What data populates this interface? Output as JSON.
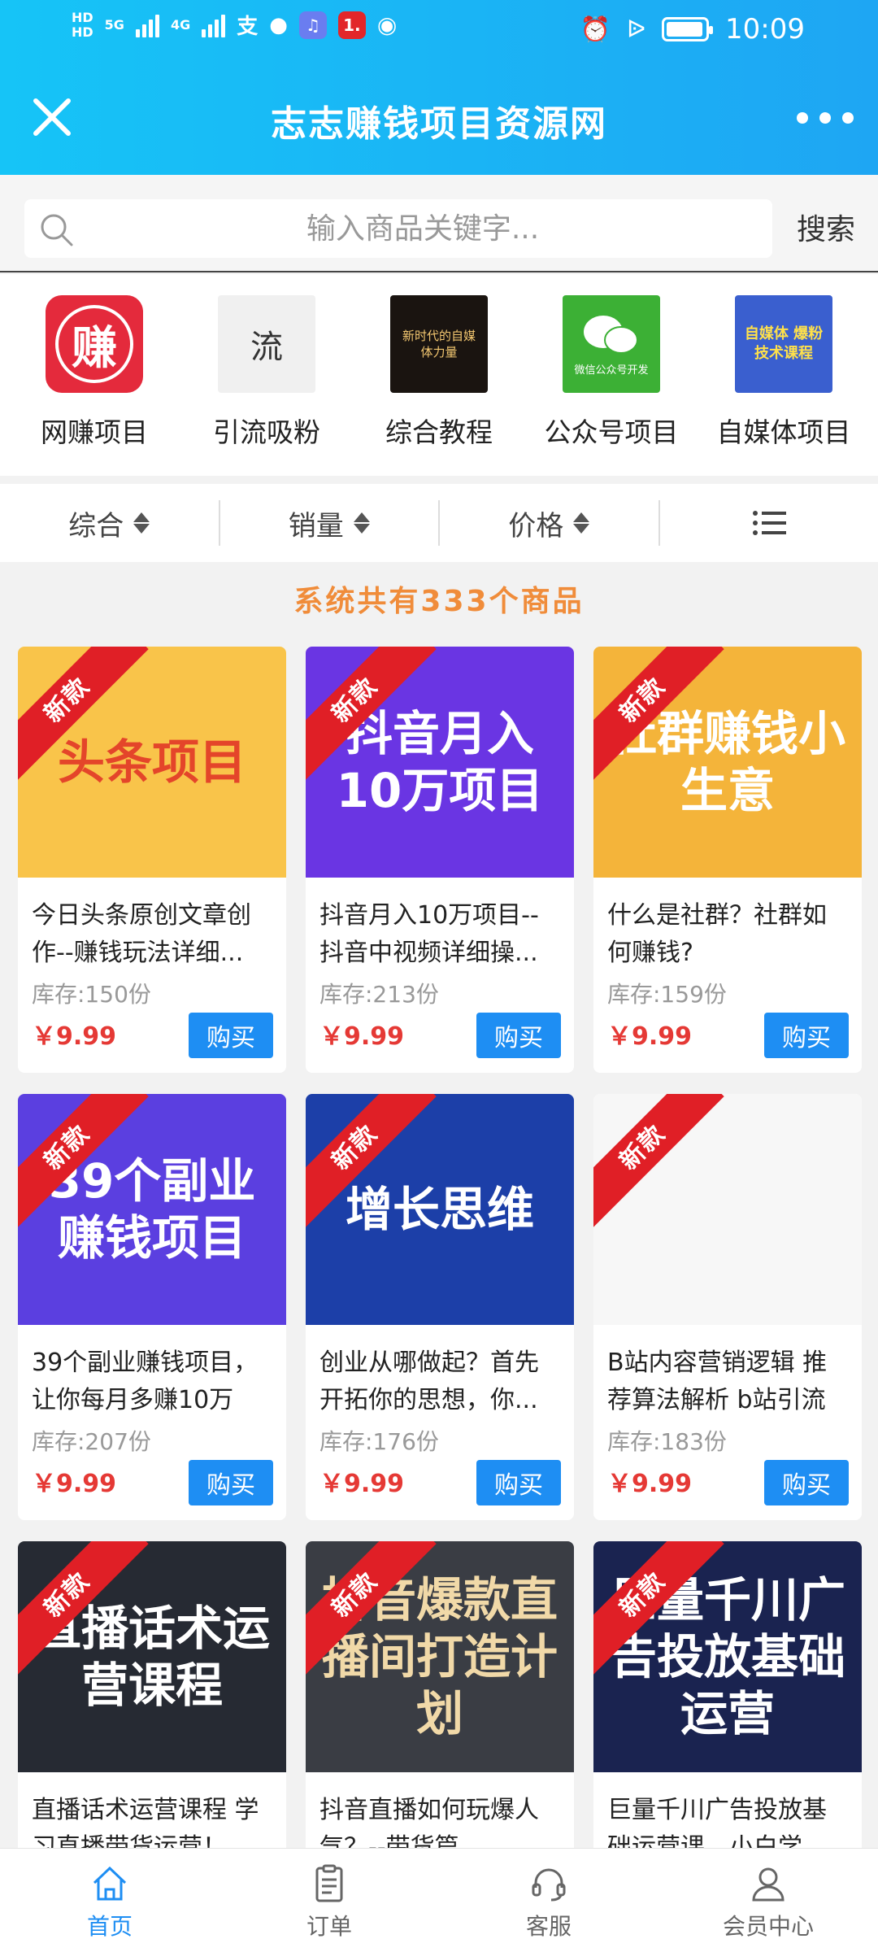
{
  "status": {
    "time": "10:09",
    "hd1": "HD",
    "hd2": "HD",
    "net1": "5G",
    "net2": "4G",
    "notif_badge": "1."
  },
  "header": {
    "title": "志志赚钱项目资源网"
  },
  "search": {
    "placeholder": "输入商品关键字...",
    "button": "搜索"
  },
  "categories": [
    {
      "label": "网赚项目",
      "icon_text": "赚"
    },
    {
      "label": "引流吸粉",
      "icon_text": "流"
    },
    {
      "label": "综合教程",
      "icon_text": "新时代的自媒体力量"
    },
    {
      "label": "公众号项目",
      "icon_text": "微信公众号开发"
    },
    {
      "label": "自媒体项目",
      "icon_text": "自媒体 爆粉技术课程"
    }
  ],
  "sort": {
    "comprehensive": "综合",
    "sales": "销量",
    "price": "价格"
  },
  "count_text": "系统共有333个商品",
  "ribbon": "新款",
  "buy_label": "购买",
  "products": [
    {
      "title": "今日头条原创文章创作--赚钱玩法详细...",
      "stock": "库存:150份",
      "price": "￥9.99",
      "banner": "头条项目",
      "bg": "#f9c44a",
      "fg": "#e4452a"
    },
    {
      "title": "抖音月入10万项目--抖音中视频详细操...",
      "stock": "库存:213份",
      "price": "￥9.99",
      "banner": "抖音月入10万项目",
      "bg": "#6a35e3",
      "fg": "#ffffff"
    },
    {
      "title": "什么是社群？社群如何赚钱?",
      "stock": "库存:159份",
      "price": "￥9.99",
      "banner": "社群赚钱小生意",
      "bg": "#f4b43a",
      "fg": "#ffffff"
    },
    {
      "title": "39个副业赚钱项目，让你每月多赚10万",
      "stock": "库存:207份",
      "price": "￥9.99",
      "banner": "39个副业赚钱项目",
      "bg": "#5b3fe0",
      "fg": "#ffffff"
    },
    {
      "title": "创业从哪做起？首先开拓你的思想，你...",
      "stock": "库存:176份",
      "price": "￥9.99",
      "banner": "增长思维",
      "bg": "#1c3fa8",
      "fg": "#ffffff"
    },
    {
      "title": "B站内容营销逻辑 推荐算法解析 b站引流",
      "stock": "库存:183份",
      "price": "￥9.99",
      "banner": "",
      "bg": "#f7f7f7",
      "fg": "#4a8d3a"
    },
    {
      "title": "直播话术运营课程 学习直播带货运营！",
      "stock": "",
      "price": "",
      "banner": "直播话术运营课程",
      "bg": "#262a33",
      "fg": "#ffffff"
    },
    {
      "title": "抖音直播如何玩爆人气？--带货篇",
      "stock": "",
      "price": "",
      "banner": "抖音爆款直播间打造计划",
      "bg": "#3a3d44",
      "fg": "#f1d9a8"
    },
    {
      "title": "巨量千川广告投放基础运营课，小白学...",
      "stock": "",
      "price": "",
      "banner": "巨量千川广告投放基础运营",
      "bg": "#1a2350",
      "fg": "#ffffff"
    }
  ],
  "nav": [
    {
      "label": "首页",
      "icon": "home-icon",
      "active": true
    },
    {
      "label": "订单",
      "icon": "order-icon",
      "active": false
    },
    {
      "label": "客服",
      "icon": "headset-icon",
      "active": false
    },
    {
      "label": "会员中心",
      "icon": "user-icon",
      "active": false
    }
  ],
  "colors": {
    "accent": "#1e8ef3",
    "header": "#1ea6f3",
    "price": "#e53935",
    "ribbon": "#e01f26",
    "count": "#f08c3a"
  }
}
